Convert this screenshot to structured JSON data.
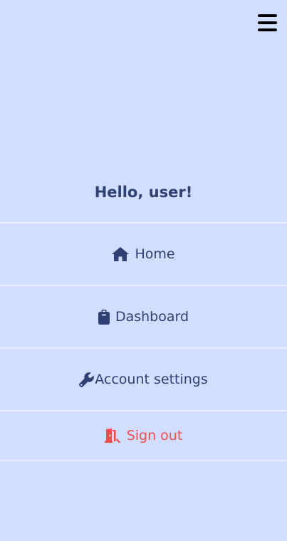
{
  "header": {
    "menu_icon": "hamburger-menu-icon"
  },
  "greeting": "Hello, user!",
  "nav": {
    "items": [
      {
        "label": "Home",
        "icon": "home-icon"
      },
      {
        "label": "Dashboard",
        "icon": "clipboard-icon"
      },
      {
        "label": "Account settings",
        "icon": "wrench-icon"
      },
      {
        "label": "Sign out",
        "icon": "door-exit-icon"
      }
    ]
  },
  "colors": {
    "background": "#d1deff",
    "text": "#2f4172",
    "danger": "#ec4d4d",
    "divider": "#e9efff"
  }
}
